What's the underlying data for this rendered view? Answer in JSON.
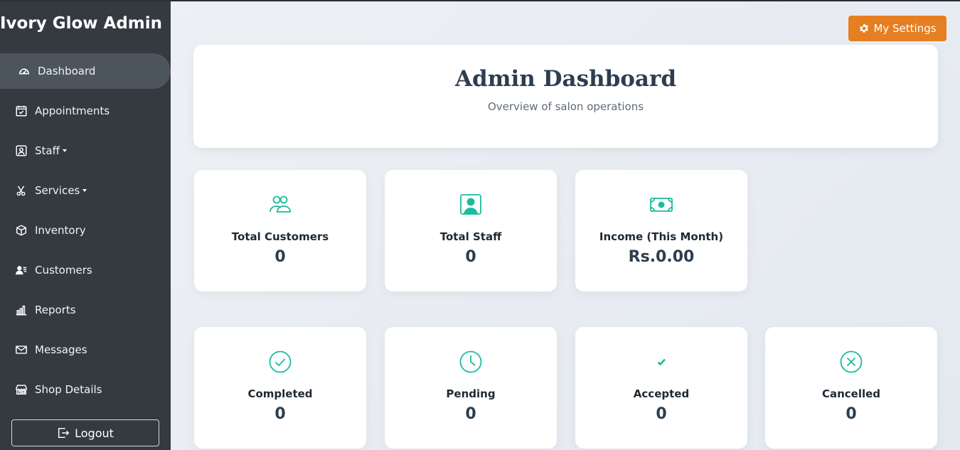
{
  "brand": "Ivory Glow Admin",
  "sidebar": {
    "items": [
      {
        "label": "Dashboard",
        "icon": "speedometer-icon",
        "active": true
      },
      {
        "label": "Appointments",
        "icon": "calendar-check-icon"
      },
      {
        "label": "Staff",
        "icon": "person-badge-icon",
        "dropdown": true
      },
      {
        "label": "Services",
        "icon": "scissors-icon",
        "dropdown": true
      },
      {
        "label": "Inventory",
        "icon": "box-icon"
      },
      {
        "label": "Customers",
        "icon": "person-lines-icon"
      },
      {
        "label": "Reports",
        "icon": "bar-chart-icon"
      },
      {
        "label": "Messages",
        "icon": "envelope-icon"
      },
      {
        "label": "Shop Details",
        "icon": "shop-icon"
      }
    ],
    "logout_label": "Logout"
  },
  "settings_button": "My Settings",
  "header": {
    "title": "Admin Dashboard",
    "subtitle": "Overview of salon operations"
  },
  "stats": [
    {
      "label": "Total Customers",
      "value": "0",
      "icon": "people-icon"
    },
    {
      "label": "Total Staff",
      "value": "0",
      "icon": "person-badge-icon"
    },
    {
      "label": "Income (This Month)",
      "value": "Rs.0.00",
      "icon": "cash-icon"
    }
  ],
  "appointment_stats": [
    {
      "label": "Completed",
      "value": "0",
      "icon": "check-circle-icon"
    },
    {
      "label": "Pending",
      "value": "0",
      "icon": "clock-icon"
    },
    {
      "label": "Accepted",
      "value": "0",
      "icon": "check-icon"
    },
    {
      "label": "Cancelled",
      "value": "0",
      "icon": "x-circle-icon"
    }
  ],
  "colors": {
    "sidebar_bg": "#343a40",
    "accent": "#1abc9c",
    "settings_button": "#e67e22",
    "title": "#2c3e50"
  }
}
